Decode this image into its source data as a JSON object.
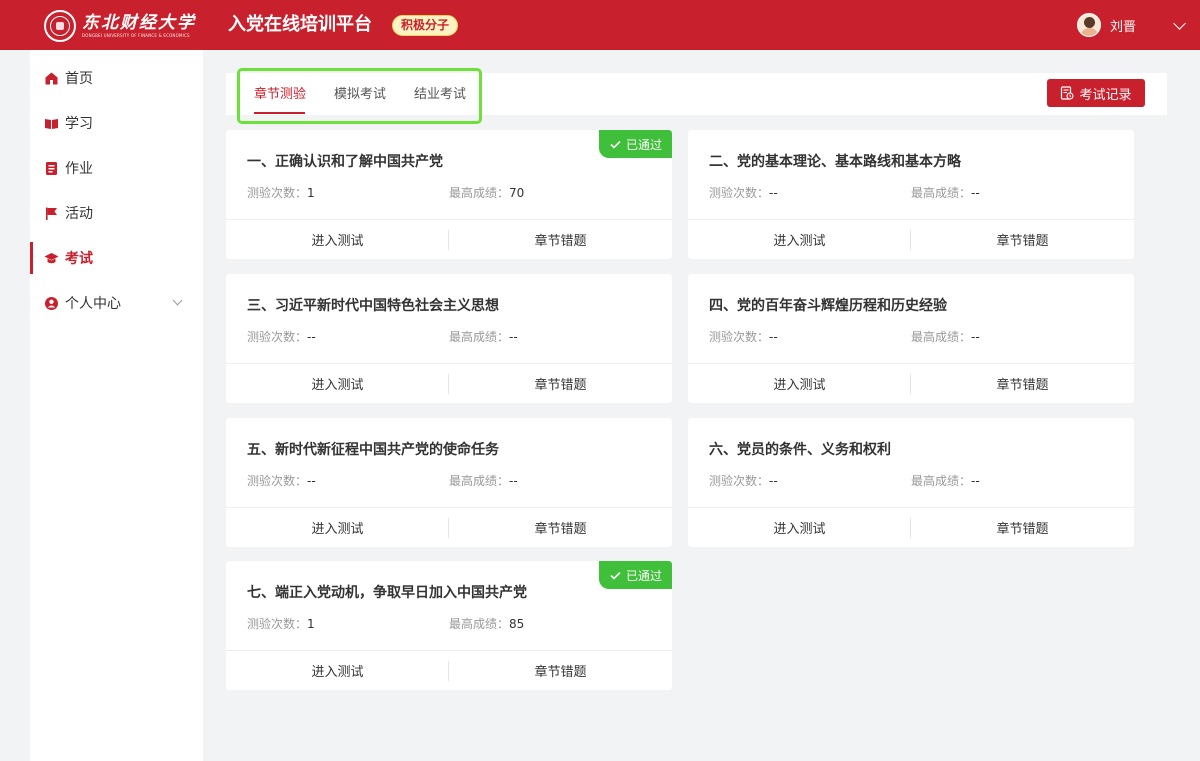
{
  "header": {
    "logo": {
      "name_cn": "东北财经大学",
      "name_en": "DONGBEI UNIVERSITY OF FINANCE & ECONOMICS",
      "seal_icon": "university-seal-icon"
    },
    "title": "入党在线培训平台",
    "role_badge": "积极分子",
    "user": {
      "name": "刘晋",
      "avatar_icon": "user-avatar-icon"
    },
    "menu_icon": "chevron-down-icon"
  },
  "sidebar": {
    "items": [
      {
        "label": "首页",
        "icon": "home-icon",
        "active": false
      },
      {
        "label": "学习",
        "icon": "book-icon",
        "active": false
      },
      {
        "label": "作业",
        "icon": "homework-icon",
        "active": false
      },
      {
        "label": "活动",
        "icon": "flag-icon",
        "active": false
      },
      {
        "label": "考试",
        "icon": "graduation-cap-icon",
        "active": true
      },
      {
        "label": "个人中心",
        "icon": "user-circle-icon",
        "active": false,
        "expandable": true
      }
    ]
  },
  "tabs": [
    {
      "label": "章节测验",
      "active": true
    },
    {
      "label": "模拟考试",
      "active": false
    },
    {
      "label": "结业考试",
      "active": false
    }
  ],
  "records_button": {
    "label": "考试记录",
    "icon": "record-icon"
  },
  "cards": [
    {
      "title": "一、正确认识和了解中国共产党",
      "attempts_label": "测验次数：",
      "attempts": "1",
      "best_label": "最高成绩：",
      "best": "70",
      "enter_label": "进入测试",
      "mistakes_label": "章节错题",
      "passed": true,
      "passed_label": "已通过"
    },
    {
      "title": "二、党的基本理论、基本路线和基本方略",
      "attempts_label": "测验次数：",
      "attempts": "--",
      "best_label": "最高成绩：",
      "best": "--",
      "enter_label": "进入测试",
      "mistakes_label": "章节错题",
      "passed": false
    },
    {
      "title": "三、习近平新时代中国特色社会主义思想",
      "attempts_label": "测验次数：",
      "attempts": "--",
      "best_label": "最高成绩：",
      "best": "--",
      "enter_label": "进入测试",
      "mistakes_label": "章节错题",
      "passed": false
    },
    {
      "title": "四、党的百年奋斗辉煌历程和历史经验",
      "attempts_label": "测验次数：",
      "attempts": "--",
      "best_label": "最高成绩：",
      "best": "--",
      "enter_label": "进入测试",
      "mistakes_label": "章节错题",
      "passed": false
    },
    {
      "title": "五、新时代新征程中国共产党的使命任务",
      "attempts_label": "测验次数：",
      "attempts": "--",
      "best_label": "最高成绩：",
      "best": "--",
      "enter_label": "进入测试",
      "mistakes_label": "章节错题",
      "passed": false
    },
    {
      "title": "六、党员的条件、义务和权利",
      "attempts_label": "测验次数：",
      "attempts": "--",
      "best_label": "最高成绩：",
      "best": "--",
      "enter_label": "进入测试",
      "mistakes_label": "章节错题",
      "passed": false
    },
    {
      "title": "七、端正入党动机，争取早日加入中国共产党",
      "attempts_label": "测验次数：",
      "attempts": "1",
      "best_label": "最高成绩：",
      "best": "85",
      "enter_label": "进入测试",
      "mistakes_label": "章节错题",
      "passed": true,
      "passed_label": "已通过"
    }
  ],
  "colors": {
    "brand_red": "#c8202c",
    "passed_green": "#3fbf3a",
    "highlight_box": "#6ee03a",
    "page_bg": "#f2f3f5"
  }
}
